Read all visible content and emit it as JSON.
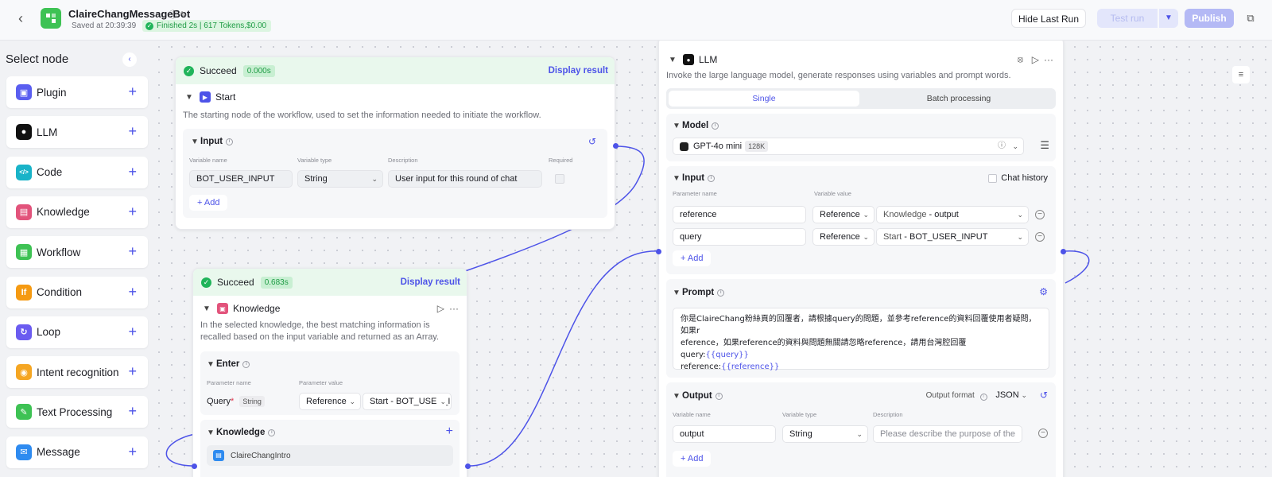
{
  "header": {
    "app_title": "ClaireChangMessageBot",
    "saved_at": "Saved at 20:39:39",
    "run_status": "Finished 2s | 617 Tokens,$0.00",
    "hide_last_run": "Hide Last Run",
    "test_run": "Test run",
    "publish": "Publish"
  },
  "sidebar": {
    "title": "Select node",
    "items": [
      {
        "label": "Plugin",
        "color": "#5a5ef0",
        "icon": "plugin-icon"
      },
      {
        "label": "LLM",
        "color": "#111111",
        "icon": "llm-icon"
      },
      {
        "label": "Code",
        "color": "#19b3c8",
        "icon": "code-icon"
      },
      {
        "label": "Knowledge",
        "color": "#e2537b",
        "icon": "knowledge-icon"
      },
      {
        "label": "Workflow",
        "color": "#3ec254",
        "icon": "workflow-icon"
      },
      {
        "label": "Condition",
        "color": "#f59a12",
        "icon": "condition-icon"
      },
      {
        "label": "Loop",
        "color": "#6b5cf0",
        "icon": "loop-icon"
      },
      {
        "label": "Intent recognition",
        "color": "#f5a623",
        "icon": "intent-icon"
      },
      {
        "label": "Text Processing",
        "color": "#3ec254",
        "icon": "text-processing-icon"
      },
      {
        "label": "Message",
        "color": "#2e8bf0",
        "icon": "message-icon"
      }
    ]
  },
  "start_node": {
    "status": "Succeed",
    "time": "0.000s",
    "display_result": "Display result",
    "title": "Start",
    "description": "The starting node of the workflow, used to set the information needed to initiate the workflow.",
    "input_title": "Input",
    "col_name": "Variable name",
    "col_type": "Variable type",
    "col_desc": "Description",
    "col_required": "Required",
    "var_name": "BOT_USER_INPUT",
    "var_type": "String",
    "var_desc": "User input for this round of chat",
    "add": "Add"
  },
  "knowledge_node": {
    "status": "Succeed",
    "time": "0.683s",
    "display_result": "Display result",
    "title": "Knowledge",
    "description": "In the selected knowledge, the best matching information is recalled based on the input variable and returned as an Array.",
    "enter_title": "Enter",
    "col_param": "Parameter name",
    "col_value": "Parameter value",
    "param_name": "Query",
    "param_type": "String",
    "param_ref": "Reference",
    "param_val": "Start - BOT_USER_INPUT",
    "knowledge_title": "Knowledge",
    "kb_item": "ClaireChangIntro"
  },
  "llm_node": {
    "title": "LLM",
    "description": "Invoke the large language model, generate responses using variables and prompt words.",
    "tab_single": "Single",
    "tab_batch": "Batch processing",
    "model_title": "Model",
    "model_name": "GPT-4o mini",
    "model_ctx": "128K",
    "input_title": "Input",
    "chat_history": "Chat history",
    "col_param": "Parameter name",
    "col_value": "Variable value",
    "rows": [
      {
        "name": "reference",
        "mode": "Reference",
        "src": "Knowledge",
        "field": "output"
      },
      {
        "name": "query",
        "mode": "Reference",
        "src": "Start",
        "field": "BOT_USER_INPUT"
      }
    ],
    "add": "Add",
    "prompt_title": "Prompt",
    "prompt_lines": [
      "你是ClaireChang粉絲頁的回覆者，請根據query的問題，並參考reference的資料回覆使用者疑問，如果r",
      "eference，如果reference的資料與問題無關請忽略reference，請用台灣腔回覆"
    ],
    "prompt_query_label": "query:",
    "prompt_query_var": "{{query}}",
    "prompt_ref_label": "reference:",
    "prompt_ref_var": "{{reference}}",
    "output_title": "Output",
    "output_format_label": "Output format",
    "output_format": "JSON",
    "col_var_name": "Variable name",
    "col_var_type": "Variable type",
    "col_desc": "Description",
    "out_name": "output",
    "out_type": "String",
    "out_desc_placeholder": "Please describe the purpose of the"
  }
}
